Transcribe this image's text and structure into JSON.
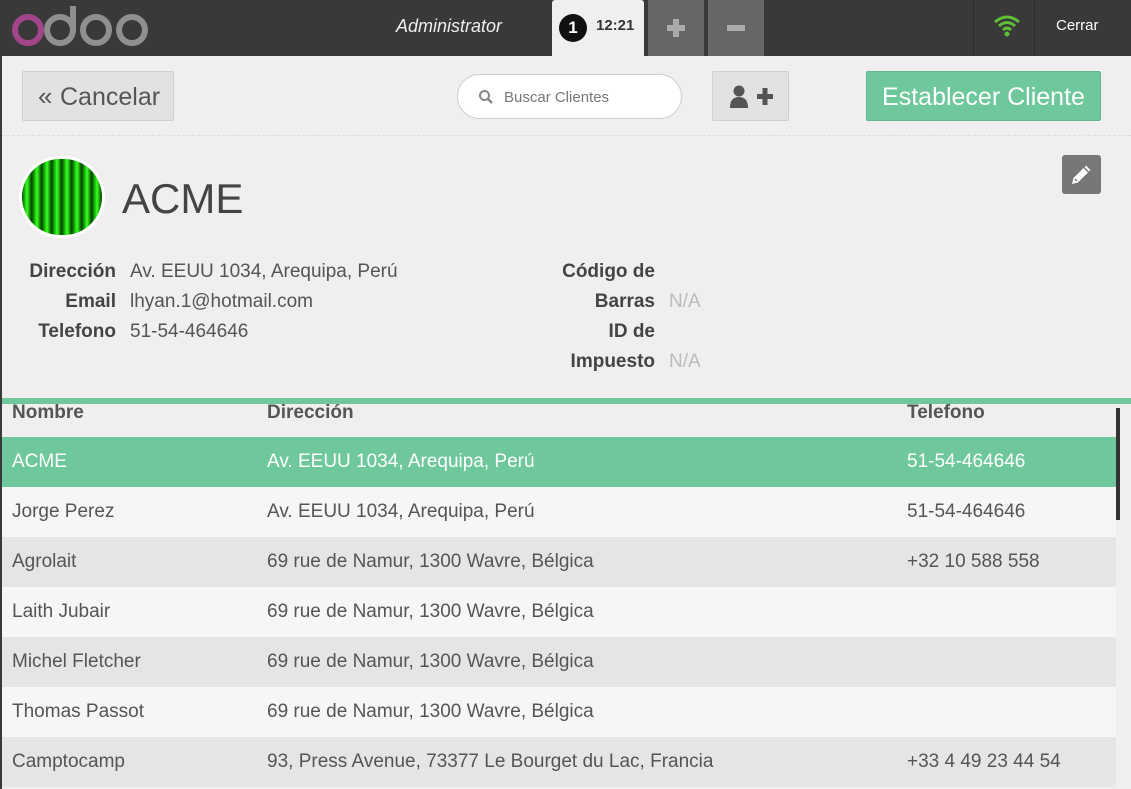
{
  "topbar": {
    "logo_text": "odoo",
    "cashier": "Administrator",
    "order_number": "1",
    "order_time": "12:21",
    "add_order_icon": "plus-icon",
    "remove_order_icon": "minus-icon",
    "connection_icon": "wifi-icon",
    "close_label": "Cerrar",
    "wifi_color": "#5fbf36"
  },
  "actions": {
    "cancel_label": "Cancelar",
    "search_placeholder": "Buscar Clientes",
    "new_customer_icon": "add-user-icon",
    "set_customer_label": "Establecer Cliente",
    "accent_color": "#6ec89b"
  },
  "client": {
    "name": "ACME",
    "edit_icon": "pencil-icon",
    "labels": {
      "address": "Dirección",
      "email": "Email",
      "phone": "Telefono",
      "barcode_line1": "Código de",
      "barcode_line2": "Barras",
      "tax_line1": "ID de",
      "tax_line2": "Impuesto"
    },
    "address": "Av. EEUU 1034, Arequipa, Perú",
    "email": "lhyan.1@hotmail.com",
    "phone": "51-54-464646",
    "barcode": "N/A",
    "tax_id": "N/A"
  },
  "table": {
    "headers": [
      "Nombre",
      "Dirección",
      "Telefono"
    ],
    "rows": [
      {
        "name": "ACME",
        "address": "Av. EEUU 1034, Arequipa, Perú",
        "phone": "51-54-464646"
      },
      {
        "name": "Jorge Perez",
        "address": "Av. EEUU 1034, Arequipa, Perú",
        "phone": "51-54-464646"
      },
      {
        "name": "Agrolait",
        "address": "69 rue de Namur, 1300 Wavre, Bélgica",
        "phone": "+32 10 588 558"
      },
      {
        "name": "Laith Jubair",
        "address": "69 rue de Namur, 1300 Wavre, Bélgica",
        "phone": ""
      },
      {
        "name": "Michel Fletcher",
        "address": "69 rue de Namur, 1300 Wavre, Bélgica",
        "phone": ""
      },
      {
        "name": "Thomas Passot",
        "address": "69 rue de Namur, 1300 Wavre, Bélgica",
        "phone": ""
      },
      {
        "name": "Camptocamp",
        "address": "93, Press Avenue, 73377 Le Bourget du Lac, Francia",
        "phone": "+33 4 49 23 44 54"
      }
    ]
  }
}
